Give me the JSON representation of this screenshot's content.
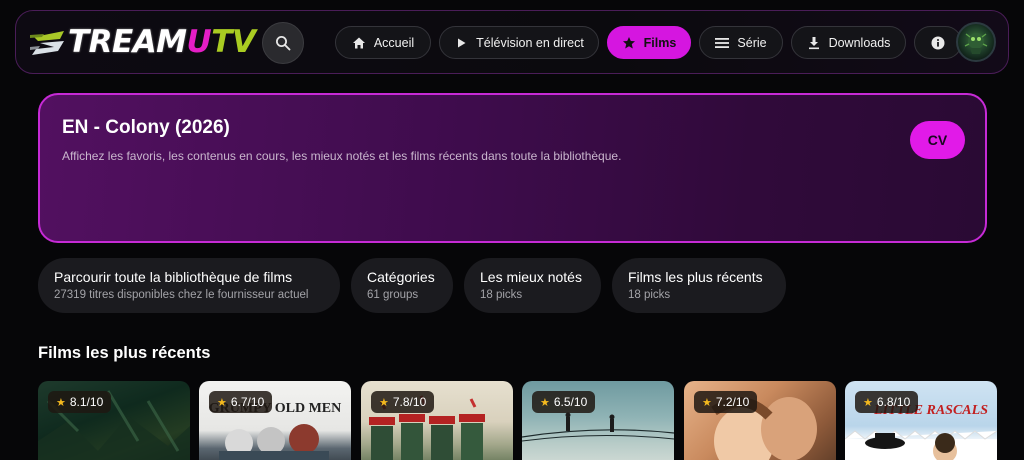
{
  "app": {
    "logo_main": "TREAM",
    "logo_u": "U",
    "logo_tv": "TV"
  },
  "nav": {
    "items": [
      {
        "label": "Accueil",
        "icon": "home-icon"
      },
      {
        "label": "Télévision en direct",
        "icon": "play-icon"
      },
      {
        "label": "Films",
        "icon": "star-icon",
        "active": true
      },
      {
        "label": "Série",
        "icon": "menu-icon"
      },
      {
        "label": "Downloads",
        "icon": "download-icon"
      },
      {
        "label": "",
        "icon": "info-icon"
      }
    ],
    "search_icon": "search-icon",
    "avatar_icon": "avatar"
  },
  "hero": {
    "title": "EN - Colony (2026)",
    "subtitle": "Affichez les favoris, les contenus en cours, les mieux notés et les films récents dans toute la bibliothèque.",
    "button": "CV"
  },
  "chips": [
    {
      "title": "Parcourir toute la bibliothèque de films",
      "subtitle": "27319 titres disponibles chez le fournisseur actuel"
    },
    {
      "title": "Catégories",
      "subtitle": "61 groups"
    },
    {
      "title": "Les mieux notés",
      "subtitle": "18 picks"
    },
    {
      "title": "Films les plus récents",
      "subtitle": "18 picks"
    }
  ],
  "recent": {
    "title": "Films les plus récents",
    "posters": [
      {
        "rating": "8.1/10",
        "caption": ""
      },
      {
        "rating": "6.7/10",
        "caption": "GRUMPY OLD MEN"
      },
      {
        "rating": "7.8/10",
        "caption": ""
      },
      {
        "rating": "6.5/10",
        "caption": ""
      },
      {
        "rating": "7.2/10",
        "caption": ""
      },
      {
        "rating": "6.8/10",
        "caption": "LITTLE RASCALS"
      }
    ]
  },
  "colors": {
    "accent": "#d516e0",
    "hero_border": "#c62ad6",
    "logo_u": "#e51ec6",
    "logo_tv": "#aacc22",
    "rating_star": "#f4b91e"
  }
}
